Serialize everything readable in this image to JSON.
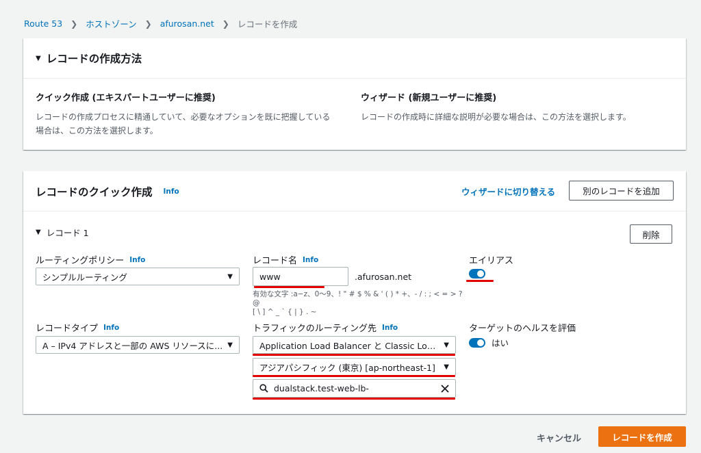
{
  "breadcrumb": {
    "items": [
      "Route 53",
      "ホストゾーン",
      "afurosan.net"
    ],
    "current": "レコードを作成"
  },
  "method_panel": {
    "title": "レコードの作成方法",
    "quick": {
      "title": "クイック作成 (エキスパートユーザーに推奨)",
      "desc_line1": "レコードの作成プロセスに精通していて、必要なオプションを既に把握している",
      "desc_line2": "場合は、この方法を選択します。"
    },
    "wizard": {
      "title": "ウィザード (新規ユーザーに推奨)",
      "desc": "レコードの作成時に詳細な説明が必要な場合は、この方法を選択します。"
    }
  },
  "quick_panel": {
    "title": "レコードのクイック作成",
    "info": "Info",
    "switch_link": "ウィザードに切り替える",
    "add_button": "別のレコードを追加",
    "record_label": "レコード 1",
    "delete_button": "削除",
    "routing_policy": {
      "label": "ルーティングポリシー",
      "info": "Info",
      "value": "シンプルルーティング"
    },
    "record_name": {
      "label": "レコード名",
      "info": "Info",
      "value": "www",
      "suffix": ".afurosan.net",
      "hint_line1": "有効な文字 :a−z、0〜9、! \" # $ % & ' ( ) * +、- / : ; < = > ? @",
      "hint_line2": "[ \\ ] ^ _ ` { | } . ~"
    },
    "alias": {
      "label": "エイリアス",
      "on": true
    },
    "record_type": {
      "label": "レコードタイプ",
      "info": "Info",
      "value": "A – IPv4 アドレスと一部の AWS リソースに..."
    },
    "route_traffic": {
      "label": "トラフィックのルーティング先",
      "info": "Info",
      "endpoint": "Application Load Balancer と Classic Load B...",
      "region": "アジアパシフィック (東京) [ap-northeast-1]",
      "search_value": "dualstack.test-web-lb-"
    },
    "health": {
      "label": "ターゲットのヘルスを評価",
      "toggle_label": "はい",
      "on": true
    }
  },
  "footer": {
    "cancel": "キャンセル",
    "create": "レコードを作成"
  },
  "colors": {
    "accent": "#0073bb",
    "primary_button": "#ec7211",
    "highlight": "#e20000"
  }
}
